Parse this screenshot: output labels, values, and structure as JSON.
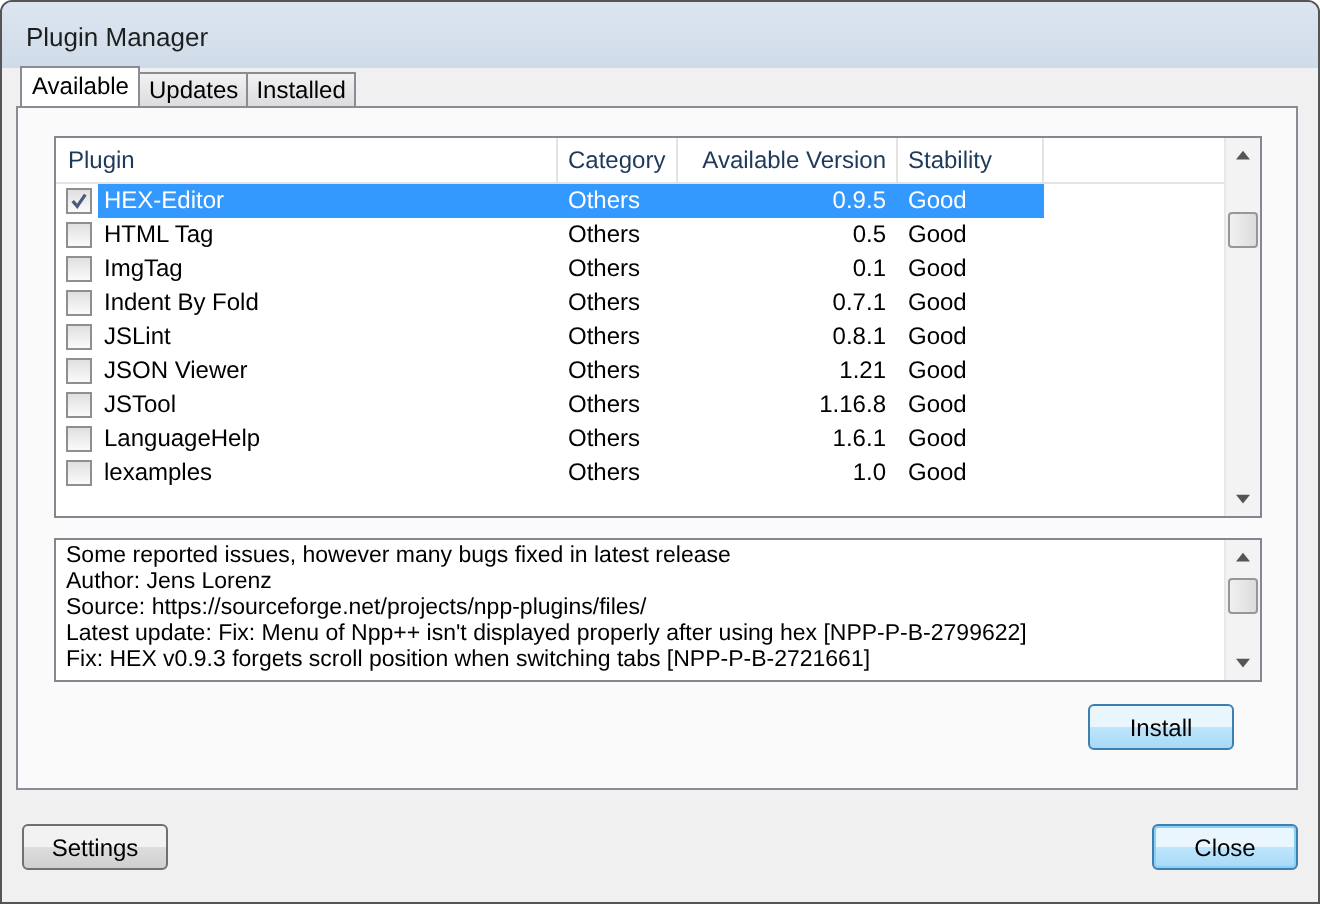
{
  "window": {
    "title": "Plugin Manager"
  },
  "tabs": [
    {
      "label": "Available",
      "selected": true
    },
    {
      "label": "Updates",
      "selected": false
    },
    {
      "label": "Installed",
      "selected": false
    }
  ],
  "table": {
    "columns": [
      "Plugin",
      "Category",
      "Available Version",
      "Stability"
    ],
    "rows": [
      {
        "name": "HEX-Editor",
        "category": "Others",
        "version": "0.9.5",
        "stability": "Good",
        "checked": true,
        "selected": true
      },
      {
        "name": "HTML Tag",
        "category": "Others",
        "version": "0.5",
        "stability": "Good",
        "checked": false,
        "selected": false
      },
      {
        "name": "ImgTag",
        "category": "Others",
        "version": "0.1",
        "stability": "Good",
        "checked": false,
        "selected": false
      },
      {
        "name": "Indent By Fold",
        "category": "Others",
        "version": "0.7.1",
        "stability": "Good",
        "checked": false,
        "selected": false
      },
      {
        "name": "JSLint",
        "category": "Others",
        "version": "0.8.1",
        "stability": "Good",
        "checked": false,
        "selected": false
      },
      {
        "name": "JSON Viewer",
        "category": "Others",
        "version": "1.21",
        "stability": "Good",
        "checked": false,
        "selected": false
      },
      {
        "name": "JSTool",
        "category": "Others",
        "version": "1.16.8",
        "stability": "Good",
        "checked": false,
        "selected": false
      },
      {
        "name": "LanguageHelp",
        "category": "Others",
        "version": "1.6.1",
        "stability": "Good",
        "checked": false,
        "selected": false
      },
      {
        "name": "lexamples",
        "category": "Others",
        "version": "1.0",
        "stability": "Good",
        "checked": false,
        "selected": false
      }
    ]
  },
  "description": [
    "Some reported issues, however many bugs fixed in latest release",
    "Author: Jens Lorenz",
    "Source: https://sourceforge.net/projects/npp-plugins/files/",
    "Latest update: Fix: Menu of Npp++ isn't displayed properly after using hex [NPP-P-B-2799622]",
    "Fix: HEX v0.9.3 forgets scroll position when switching tabs [NPP-P-B-2721661]"
  ],
  "install_button": "Install",
  "settings_button": "Settings",
  "close_button": "Close"
}
